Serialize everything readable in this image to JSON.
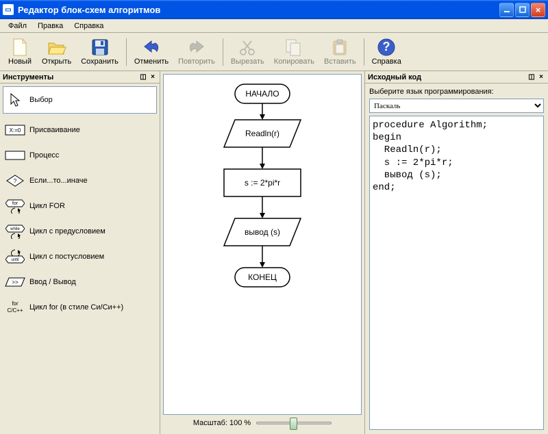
{
  "window": {
    "title": "Редактор блок-схем алгоритмов"
  },
  "menu": {
    "file": "Файл",
    "edit": "Правка",
    "help": "Справка"
  },
  "toolbar": {
    "new": "Новый",
    "open": "Открыть",
    "save": "Сохранить",
    "undo": "Отменить",
    "redo": "Повторить",
    "cut": "Вырезать",
    "copy": "Копировать",
    "paste": "Вставить",
    "help": "Справка"
  },
  "panels": {
    "tools_title": "Инструменты",
    "code_title": "Исходный код",
    "lang_label": "Выберите язык программирования:",
    "lang_value": "Паскаль"
  },
  "tools": [
    {
      "name": "select",
      "label": "Выбор"
    },
    {
      "name": "assign",
      "label": "Присваивание"
    },
    {
      "name": "process",
      "label": "Процесс"
    },
    {
      "name": "if",
      "label": "Если...то...иначе"
    },
    {
      "name": "for",
      "label": "Цикл FOR"
    },
    {
      "name": "while",
      "label": "Цикл с предусловием"
    },
    {
      "name": "until",
      "label": "Цикл с постусловием"
    },
    {
      "name": "io",
      "label": "Ввод / Вывод"
    },
    {
      "name": "cfor",
      "label": "Цикл for (в стиле Си/Си++)"
    }
  ],
  "flowchart": {
    "start": "НАЧАЛО",
    "read": "Readln(r)",
    "calc": "s := 2*pi*r",
    "output": "вывод (s)",
    "end": "КОНЕЦ"
  },
  "zoom": {
    "label": "Масштаб: 100 %"
  },
  "code": "procedure Algorithm;\nbegin\n  Readln(r);\n  s := 2*pi*r;\n  вывод (s);\nend;"
}
